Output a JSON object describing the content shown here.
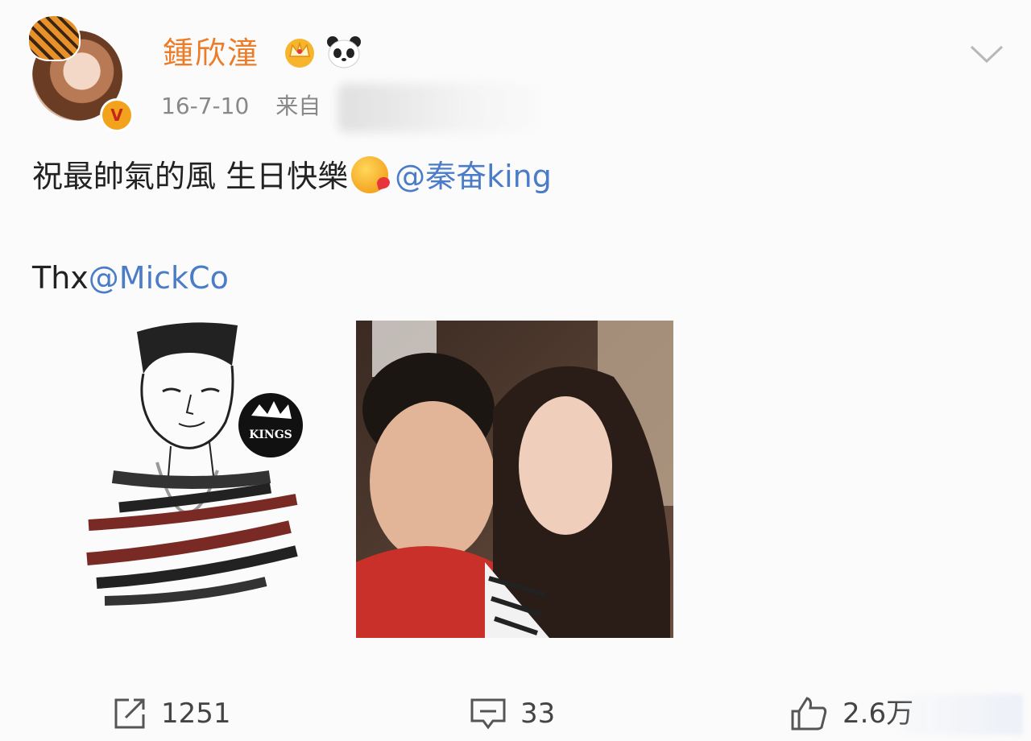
{
  "post": {
    "author": "鍾欣潼",
    "time": "16-7-10",
    "source_prefix": "来自",
    "text_main": "祝最帥氣的風 生日快樂",
    "mention1": "@秦奋king",
    "thanks_prefix": "Thx",
    "mention2": "@MickCo",
    "verified_badge": "V",
    "sketch_badge": "KINGS"
  },
  "actions": {
    "repost_count": "1251",
    "comment_count": "33",
    "like_count": "2.6万"
  },
  "icons": [
    "crown-icon",
    "panda-icon",
    "chevron-down-icon",
    "repost-icon",
    "comment-icon",
    "like-icon",
    "kiss-emoji-icon"
  ],
  "colors": {
    "name": "#eb7d2a",
    "mention": "#4b7cc8",
    "meta": "#888888",
    "verified": "#f3a21b"
  }
}
